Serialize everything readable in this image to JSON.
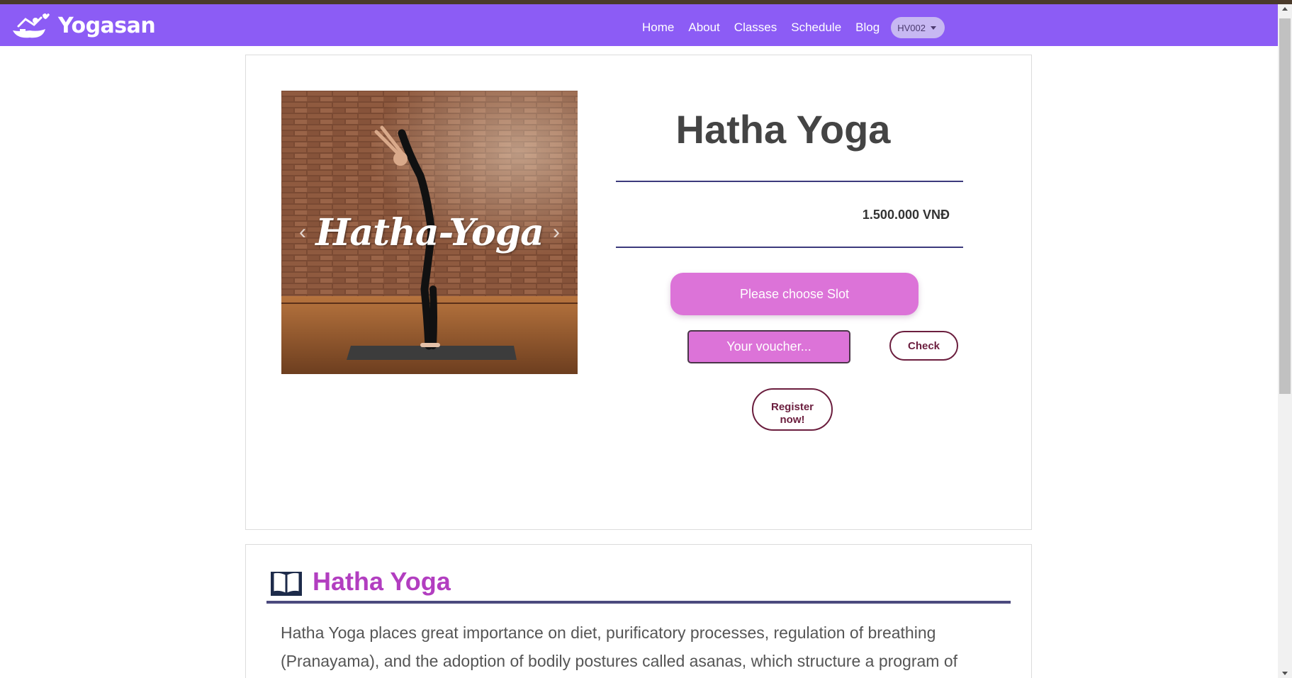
{
  "brand": {
    "name": "Yogasan"
  },
  "nav": {
    "links": [
      "Home",
      "About",
      "Classes",
      "Schedule",
      "Blog"
    ],
    "user_code": "HV002"
  },
  "carousel": {
    "caption": "Hatha-Yoga"
  },
  "class_info": {
    "title": "Hatha Yoga",
    "price": "1.500.000 VNĐ",
    "slot_button": "Please choose Slot",
    "voucher_placeholder": "Your voucher...",
    "check_button": "Check",
    "register_button": "Register now!"
  },
  "about": {
    "title": "Hatha Yoga",
    "text": "Hatha Yoga places great importance on diet, purificatory processes, regulation of breathing (Pranayama), and the adoption of bodily postures called asanas, which structure a program of"
  },
  "colors": {
    "navbar": "#8c5cf5",
    "accent_pink": "#dc73d8",
    "title_purple": "#b23ec0",
    "rule": "#3c3a7c",
    "button_border": "#6b1e3e"
  },
  "icons": [
    "yoga-logo-icon",
    "caret-down-icon",
    "chevron-left-icon",
    "chevron-right-icon",
    "book-icon"
  ]
}
